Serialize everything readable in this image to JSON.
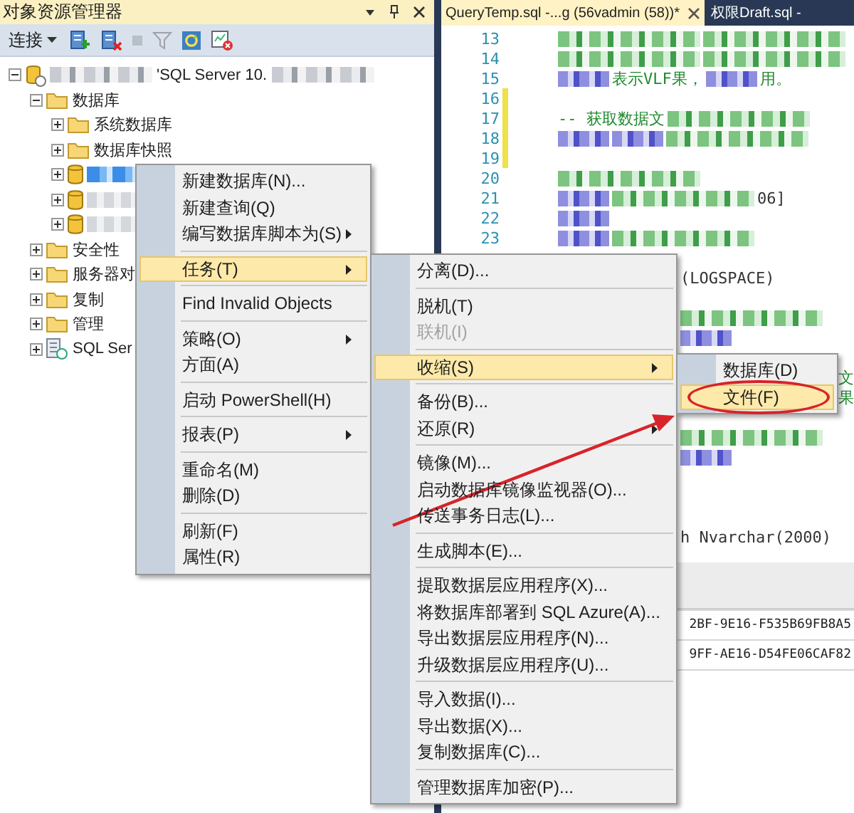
{
  "object_explorer": {
    "title": "对象资源管理器",
    "connect_label": "连接",
    "tree": [
      {
        "kind": "server",
        "label": "'SQL Server 10.",
        "expanded": true,
        "selected": false,
        "children": [
          {
            "kind": "folder",
            "label": "数据库",
            "expanded": true,
            "selected": false,
            "children": [
              {
                "kind": "folder",
                "label": "系统数据库",
                "expanded": false,
                "selected": false
              },
              {
                "kind": "folder",
                "label": "数据库快照",
                "expanded": false,
                "selected": false
              },
              {
                "kind": "database",
                "expanded": false,
                "selected": true
              },
              {
                "kind": "database",
                "expanded": false,
                "selected": false
              },
              {
                "kind": "database",
                "expanded": false,
                "selected": false
              }
            ]
          },
          {
            "kind": "folder",
            "label": "安全性",
            "expanded": false,
            "selected": false
          },
          {
            "kind": "folder",
            "label": "服务器对",
            "expanded": false,
            "selected": false
          },
          {
            "kind": "folder",
            "label": "复制",
            "expanded": false,
            "selected": false
          },
          {
            "kind": "folder",
            "label": "管理",
            "expanded": false,
            "selected": false
          },
          {
            "kind": "agent",
            "label": "SQL Ser",
            "expanded": false,
            "selected": false
          }
        ]
      }
    ]
  },
  "editor": {
    "tabs": [
      {
        "label": "QueryTemp.sql -...g (56vadmin (58))*",
        "selected": true
      },
      {
        "label": "权限Draft.sql -",
        "selected": false
      }
    ],
    "lines": [
      {
        "kind": "numbered",
        "number": "13",
        "changed": false,
        "segments": [
          {
            "kind": "comment-blur"
          },
          {
            "kind": "comment-blur"
          }
        ]
      },
      {
        "kind": "numbered",
        "number": "14",
        "changed": false,
        "segments": [
          {
            "kind": "comment-blur"
          },
          {
            "kind": "comment-blur"
          }
        ]
      },
      {
        "kind": "numbered",
        "number": "15",
        "changed": false,
        "segments": [
          {
            "kind": "keyword-blur"
          },
          {
            "kind": "comment-text",
            "text": "表示VLF果，"
          },
          {
            "kind": "keyword-blur"
          },
          {
            "kind": "comment-text",
            "text": "用。"
          }
        ]
      },
      {
        "kind": "numbered",
        "number": "16",
        "changed": true
      },
      {
        "kind": "numbered",
        "number": "17",
        "changed": true,
        "segments": [
          {
            "kind": "comment-text",
            "text": "-- 获取数据文"
          },
          {
            "kind": "comment-blur"
          }
        ]
      },
      {
        "kind": "numbered",
        "number": "18",
        "changed": true,
        "segments": [
          {
            "kind": "keyword-blur"
          },
          {
            "kind": "keyword-blur"
          },
          {
            "kind": "comment-blur"
          }
        ]
      },
      {
        "kind": "numbered",
        "number": "19",
        "changed": true
      },
      {
        "kind": "numbered",
        "number": "20",
        "changed": false,
        "segments": [
          {
            "kind": "comment-blur"
          }
        ]
      },
      {
        "kind": "numbered",
        "number": "21",
        "changed": false,
        "segments": [
          {
            "kind": "keyword-blur"
          },
          {
            "kind": "comment-blur"
          },
          {
            "kind": "plain-text",
            "text": "06]"
          }
        ]
      },
      {
        "kind": "numbered",
        "number": "22",
        "changed": false,
        "segments": [
          {
            "kind": "keyword-blur"
          }
        ]
      },
      {
        "kind": "numbered",
        "number": "23",
        "changed": false,
        "segments": [
          {
            "kind": "keyword-blur"
          },
          {
            "kind": "comment-blur"
          }
        ]
      },
      {
        "kind": "continued"
      },
      {
        "kind": "continued",
        "segments": [
          {
            "kind": "plain-text",
            "text": "(LOGSPACE)"
          }
        ]
      },
      {
        "kind": "continued"
      },
      {
        "kind": "continued",
        "segments": [
          {
            "kind": "comment-blur"
          }
        ]
      },
      {
        "kind": "continued",
        "segments": [
          {
            "kind": "keyword-blur"
          }
        ]
      },
      {
        "kind": "continued"
      },
      {
        "kind": "tail",
        "segments": [
          {
            "kind": "comment-text",
            "text": "文"
          }
        ]
      },
      {
        "kind": "tail",
        "segments": [
          {
            "kind": "comment-text",
            "text": "果"
          }
        ]
      },
      {
        "kind": "continued"
      },
      {
        "kind": "continued",
        "segments": [
          {
            "kind": "comment-blur"
          }
        ]
      },
      {
        "kind": "continued",
        "segments": [
          {
            "kind": "keyword-blur"
          }
        ]
      },
      {
        "kind": "continued"
      },
      {
        "kind": "continued"
      },
      {
        "kind": "continued"
      },
      {
        "kind": "continued",
        "segments": [
          {
            "kind": "plain-text",
            "text": "h Nvarchar(2000)"
          }
        ]
      }
    ]
  },
  "results": {
    "rows": [
      {
        "value": "2BF-9E16-F535B69FB8A5"
      },
      {
        "value": "9FF-AE16-D54FE06CAF82"
      }
    ]
  },
  "menus": [
    {
      "items": [
        {
          "kind": "item",
          "label": "新建数据库(N)...",
          "submenu": false,
          "selected": false,
          "disabled": false
        },
        {
          "kind": "item",
          "label": "新建查询(Q)",
          "submenu": false,
          "selected": false,
          "disabled": false
        },
        {
          "kind": "item",
          "label": "编写数据库脚本为(S)",
          "submenu": true,
          "selected": false,
          "disabled": false
        },
        {
          "kind": "separator"
        },
        {
          "kind": "item",
          "label": "任务(T)",
          "submenu": true,
          "selected": true,
          "disabled": false
        },
        {
          "kind": "separator"
        },
        {
          "kind": "item",
          "label": "Find Invalid Objects",
          "submenu": false,
          "selected": false,
          "disabled": false
        },
        {
          "kind": "separator"
        },
        {
          "kind": "item",
          "label": "策略(O)",
          "submenu": true,
          "selected": false,
          "disabled": false
        },
        {
          "kind": "item",
          "label": "方面(A)",
          "submenu": false,
          "selected": false,
          "disabled": false
        },
        {
          "kind": "separator"
        },
        {
          "kind": "item",
          "label": "启动 PowerShell(H)",
          "submenu": false,
          "selected": false,
          "disabled": false
        },
        {
          "kind": "separator"
        },
        {
          "kind": "item",
          "label": "报表(P)",
          "submenu": true,
          "selected": false,
          "disabled": false
        },
        {
          "kind": "separator"
        },
        {
          "kind": "item",
          "label": "重命名(M)",
          "submenu": false,
          "selected": false,
          "disabled": false
        },
        {
          "kind": "item",
          "label": "删除(D)",
          "submenu": false,
          "selected": false,
          "disabled": false
        },
        {
          "kind": "separator"
        },
        {
          "kind": "item",
          "label": "刷新(F)",
          "submenu": false,
          "selected": false,
          "disabled": false
        },
        {
          "kind": "item",
          "label": "属性(R)",
          "submenu": false,
          "selected": false,
          "disabled": false
        }
      ]
    },
    {
      "items": [
        {
          "kind": "item",
          "label": "分离(D)...",
          "submenu": false,
          "selected": false,
          "disabled": false
        },
        {
          "kind": "separator"
        },
        {
          "kind": "item",
          "label": "脱机(T)",
          "submenu": false,
          "selected": false,
          "disabled": false
        },
        {
          "kind": "item",
          "label": "联机(I)",
          "submenu": false,
          "selected": false,
          "disabled": true
        },
        {
          "kind": "separator"
        },
        {
          "kind": "item",
          "label": "收缩(S)",
          "submenu": true,
          "selected": true,
          "disabled": false
        },
        {
          "kind": "separator"
        },
        {
          "kind": "item",
          "label": "备份(B)...",
          "submenu": false,
          "selected": false,
          "disabled": false
        },
        {
          "kind": "item",
          "label": "还原(R)",
          "submenu": true,
          "selected": false,
          "disabled": false
        },
        {
          "kind": "separator"
        },
        {
          "kind": "item",
          "label": "镜像(M)...",
          "submenu": false,
          "selected": false,
          "disabled": false
        },
        {
          "kind": "item",
          "label": "启动数据库镜像监视器(O)...",
          "submenu": false,
          "selected": false,
          "disabled": false
        },
        {
          "kind": "item",
          "label": "传送事务日志(L)...",
          "submenu": false,
          "selected": false,
          "disabled": false
        },
        {
          "kind": "separator"
        },
        {
          "kind": "item",
          "label": "生成脚本(E)...",
          "submenu": false,
          "selected": false,
          "disabled": false
        },
        {
          "kind": "separator"
        },
        {
          "kind": "item",
          "label": "提取数据层应用程序(X)...",
          "submenu": false,
          "selected": false,
          "disabled": false
        },
        {
          "kind": "item",
          "label": "将数据库部署到 SQL Azure(A)...",
          "submenu": false,
          "selected": false,
          "disabled": false
        },
        {
          "kind": "item",
          "label": "导出数据层应用程序(N)...",
          "submenu": false,
          "selected": false,
          "disabled": false
        },
        {
          "kind": "item",
          "label": "升级数据层应用程序(U)...",
          "submenu": false,
          "selected": false,
          "disabled": false
        },
        {
          "kind": "separator"
        },
        {
          "kind": "item",
          "label": "导入数据(I)...",
          "submenu": false,
          "selected": false,
          "disabled": false
        },
        {
          "kind": "item",
          "label": "导出数据(X)...",
          "submenu": false,
          "selected": false,
          "disabled": false
        },
        {
          "kind": "item",
          "label": "复制数据库(C)...",
          "submenu": false,
          "selected": false,
          "disabled": false
        },
        {
          "kind": "separator"
        },
        {
          "kind": "item",
          "label": "管理数据库加密(P)...",
          "submenu": false,
          "selected": false,
          "disabled": false
        }
      ]
    },
    {
      "items": [
        {
          "kind": "item",
          "label": "数据库(D)",
          "submenu": false,
          "selected": false,
          "disabled": false,
          "circled": false
        },
        {
          "kind": "item",
          "label": "文件(F)",
          "submenu": false,
          "selected": true,
          "disabled": false,
          "circled": true
        }
      ]
    }
  ],
  "annotations": [
    {
      "kind": "arrow"
    }
  ]
}
